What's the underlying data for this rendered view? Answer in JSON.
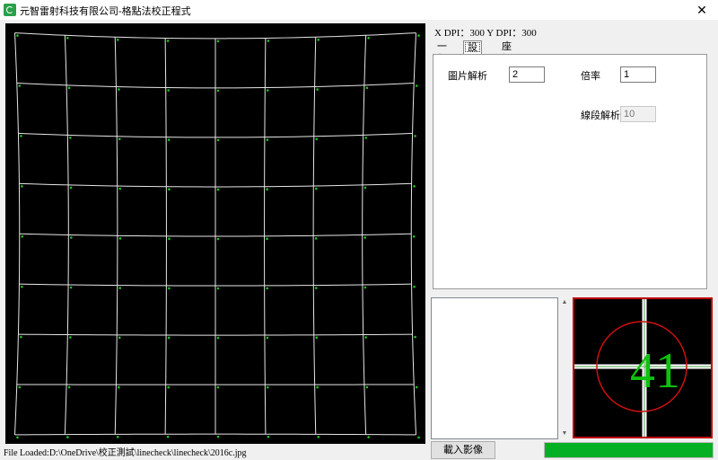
{
  "window": {
    "title": "元智雷射科技有限公司-格點法校正程式",
    "close_glyph": "✕"
  },
  "info": {
    "dpi_text": "X DPI：300 Y DPI：300"
  },
  "tabs": [
    {
      "label": "一般",
      "active": false
    },
    {
      "label": "設定",
      "active": true
    },
    {
      "label": "座標",
      "active": false
    }
  ],
  "settings": {
    "image_resolution_label": "圖片解析",
    "image_resolution_value": "2",
    "scale_label": "倍率",
    "scale_value": "1",
    "line_resolution_label": "線段解析",
    "line_resolution_value": "10"
  },
  "preview": {
    "label_text": "41",
    "circle_color": "#d01010",
    "text_color": "#10c010"
  },
  "buttons": {
    "load_image": "載入影像"
  },
  "progress": {
    "fraction": 1.0,
    "color": "#06b025"
  },
  "status": {
    "text": "File Loaded:D:\\OneDrive\\校正測試\\linecheck\\linecheck\\2016c.jpg"
  },
  "colors": {
    "grid_line": "#e6e6e6",
    "grid_label": "#22c022"
  }
}
